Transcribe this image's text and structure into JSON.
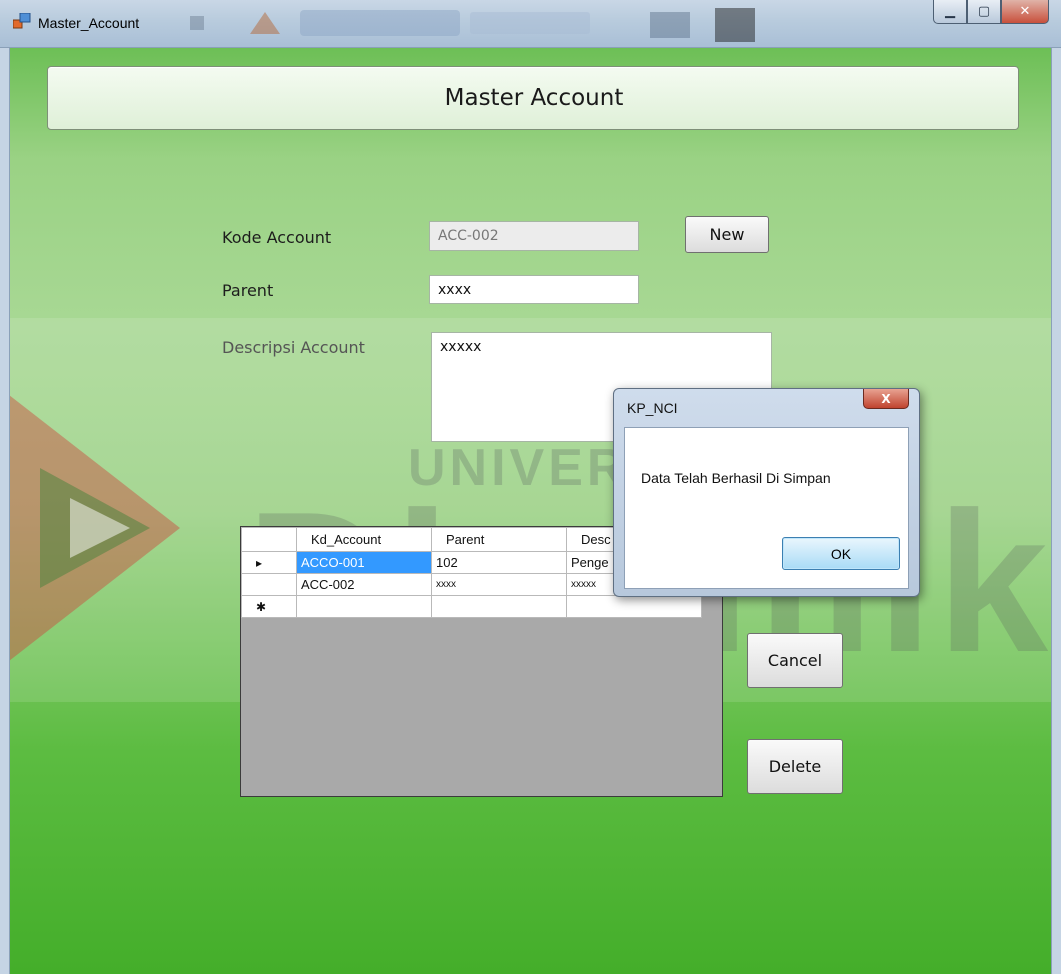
{
  "window": {
    "title": "Master_Account",
    "minimize_glyph": "▁",
    "maximize_glyph": "▢",
    "close_glyph": "✕"
  },
  "watermark": {
    "line1": "UNIVERSITAS",
    "line2": "Dinamika"
  },
  "header": {
    "title": "Master Account"
  },
  "form": {
    "kode_label": "Kode Account",
    "kode_value": "ACC-002",
    "parent_label": "Parent",
    "parent_value": "xxxx",
    "desc_label": "Descripsi Account",
    "desc_value": "xxxxx"
  },
  "buttons": {
    "new": "New",
    "cancel": "Cancel",
    "delete": "Delete"
  },
  "grid": {
    "columns": [
      "Kd_Account",
      "Parent",
      "Desc"
    ],
    "rows": [
      {
        "marker": "▸",
        "kd": "ACCO-001",
        "parent": "102",
        "desc": "Penge"
      },
      {
        "marker": "",
        "kd": "ACC-002",
        "parent": "xxxx",
        "desc": "xxxxx"
      },
      {
        "marker": "✱",
        "kd": "",
        "parent": "",
        "desc": ""
      }
    ]
  },
  "dialog": {
    "title": "KP_NCI",
    "message": "Data Telah Berhasil Di Simpan",
    "ok": "OK",
    "close_glyph": "X"
  },
  "colors": {
    "form_green": "#9ad284",
    "selection_blue": "#3399ff",
    "close_red": "#c0442f"
  }
}
